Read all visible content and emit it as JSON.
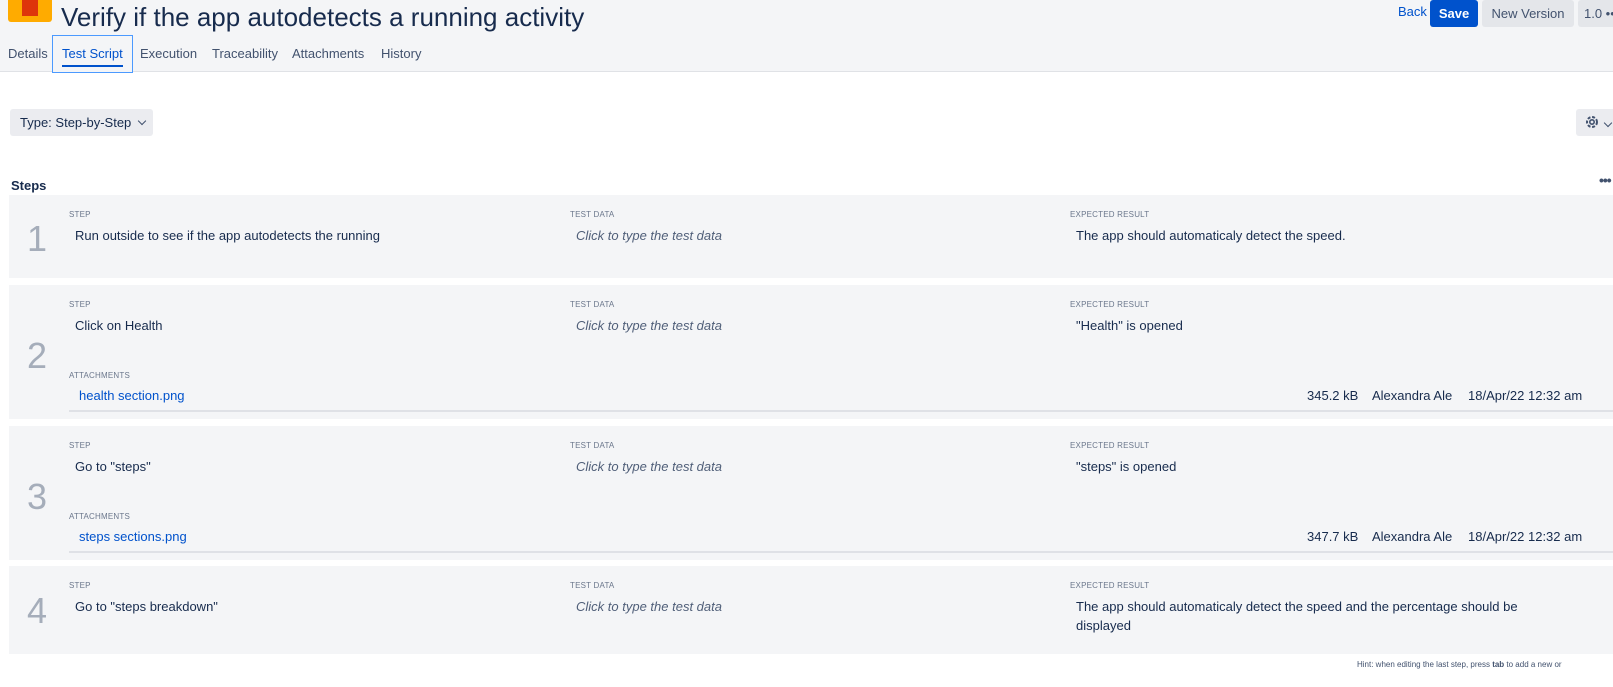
{
  "header": {
    "title": "Verify if the app autodetects a running activity",
    "back_label": "Back",
    "save_label": "Save",
    "new_version_label": "New Version",
    "version_label": "1.0 •••"
  },
  "tabs": [
    {
      "label": "Details"
    },
    {
      "label": "Test Script"
    },
    {
      "label": "Execution"
    },
    {
      "label": "Traceability"
    },
    {
      "label": "Attachments"
    },
    {
      "label": "History"
    }
  ],
  "toolbar": {
    "type_label": "Type: Step-by-Step"
  },
  "steps_section": {
    "title": "Steps",
    "more": "•••"
  },
  "columns": {
    "step": "STEP",
    "test_data": "TEST DATA",
    "expected": "EXPECTED RESULT",
    "attachments": "ATTACHMENTS"
  },
  "steps": [
    {
      "number": "1",
      "step": "Run outside to see if the app autodetects the running",
      "test_data": "Click to type the test data",
      "expected": "The app should automaticaly detect the speed."
    },
    {
      "number": "2",
      "step": "Click on Health",
      "test_data": "Click to type the test data",
      "expected": "\"Health\" is opened",
      "attachment": {
        "name": "health section.png",
        "size": "345.2 kB",
        "user": "Alexandra Ale",
        "date": "18/Apr/22 12:32 am"
      }
    },
    {
      "number": "3",
      "step": "Go to \"steps\"",
      "test_data": "Click to type the test data",
      "expected": "\"steps\" is opened",
      "attachment": {
        "name": "steps sections.png",
        "size": "347.7 kB",
        "user": "Alexandra Ale",
        "date": "18/Apr/22 12:32 am"
      }
    },
    {
      "number": "4",
      "step": "Go to \"steps breakdown\"",
      "test_data": "Click to type the test data",
      "expected": "The app should automaticaly detect the speed and the percentage should be displayed"
    }
  ],
  "hint": {
    "prefix": "Hint: when editing the last step, press ",
    "key": "tab",
    "suffix": " to add a new or"
  },
  "colors": {
    "accent": "#0052cc",
    "card_bg": "#f4f5f7",
    "logo_orange": "#ff8b00",
    "logo_red": "#de350b"
  },
  "icons": {
    "logo": "test-case-logo-icon",
    "gear": "gear-icon",
    "chevron": "chevron-down-icon"
  }
}
